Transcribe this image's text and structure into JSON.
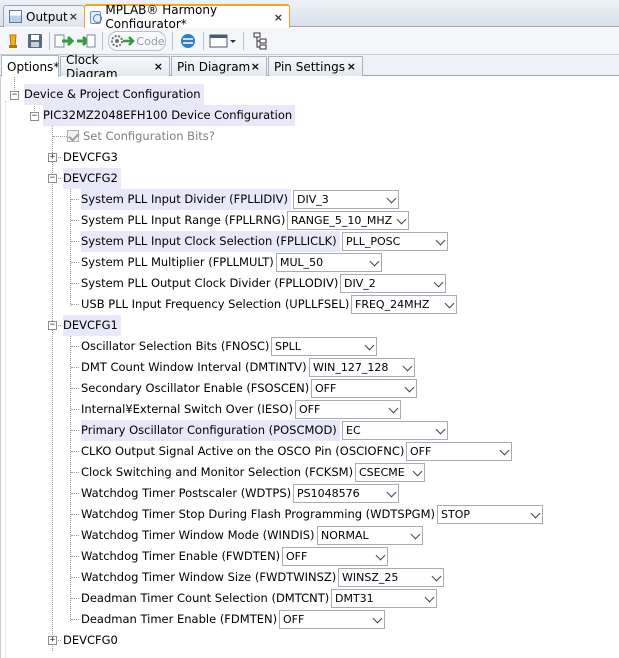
{
  "window_tabs": [
    {
      "label": "Output",
      "icon": "output-window-icon"
    },
    {
      "label": "MPLAB® Harmony Configurator*",
      "icon": "harmony-icon"
    }
  ],
  "toolbar": {
    "code_label": "Code",
    "icons": [
      "generate-icon",
      "save-icon",
      "import-icon",
      "export-icon",
      "generate-code-icon",
      "harmony-framework-icon",
      "window-layout-icon",
      "tree-view-icon"
    ]
  },
  "option_tabs": [
    {
      "label": "Options*"
    },
    {
      "label": "Clock Diagram"
    },
    {
      "label": "Pin Diagram"
    },
    {
      "label": "Pin Settings"
    }
  ],
  "tree": {
    "root": "Device & Project Configuration",
    "device": "PIC32MZ2048EFH100 Device Configuration",
    "set_config_bits": "Set Configuration Bits?",
    "devcfg3": "DEVCFG3",
    "devcfg2": "DEVCFG2",
    "devcfg1": "DEVCFG1",
    "devcfg0": "DEVCFG0",
    "devcfg2_settings": [
      {
        "label": "System PLL Input Divider (FPLLIDIV)",
        "value": "DIV_3",
        "selected": true
      },
      {
        "label": "System PLL Input Range (FPLLRNG)",
        "value": "RANGE_5_10_MHZ",
        "selected": false
      },
      {
        "label": "System PLL Input Clock Selection (FPLLICLK)",
        "value": "PLL_POSC",
        "selected": true
      },
      {
        "label": "System PLL Multiplier (FPLLMULT)",
        "value": "MUL_50",
        "selected": false
      },
      {
        "label": "System PLL Output Clock Divider (FPLLODIV)",
        "value": "DIV_2",
        "selected": false
      },
      {
        "label": "USB PLL Input Frequency Selection (UPLLFSEL)",
        "value": "FREQ_24MHZ",
        "selected": false
      }
    ],
    "devcfg1_settings": [
      {
        "label": "Oscillator Selection Bits (FNOSC)",
        "value": "SPLL",
        "selected": false
      },
      {
        "label": "DMT Count Window Interval (DMTINTV)",
        "value": "WIN_127_128",
        "selected": false
      },
      {
        "label": "Secondary Oscillator Enable (FSOSCEN)",
        "value": "OFF",
        "selected": false
      },
      {
        "label": "Internal¥External Switch Over (IESO)",
        "value": "OFF",
        "selected": false
      },
      {
        "label": "Primary Oscillator Configuration (POSCMOD)",
        "value": "EC",
        "selected": true
      },
      {
        "label": "CLKO Output Signal Active on the OSCO Pin (OSCIOFNC)",
        "value": "OFF",
        "selected": false
      },
      {
        "label": "Clock Switching and Monitor Selection (FCKSM)",
        "value": "CSECME",
        "selected": false
      },
      {
        "label": "Watchdog Timer Postscaler (WDTPS)",
        "value": "PS1048576",
        "selected": false
      },
      {
        "label": "Watchdog Timer Stop During Flash Programming (WDTSPGM)",
        "value": "STOP",
        "selected": false
      },
      {
        "label": "Watchdog Timer Window Mode (WINDIS)",
        "value": "NORMAL",
        "selected": false
      },
      {
        "label": "Watchdog Timer Enable (FWDTEN)",
        "value": "OFF",
        "selected": false
      },
      {
        "label": "Watchdog Timer Window Size (FWDTWINSZ)",
        "value": "WINSZ_25",
        "selected": false
      },
      {
        "label": "Deadman Timer Count Selection (DMTCNT)",
        "value": "DMT31",
        "selected": false
      },
      {
        "label": "Deadman Timer Enable (FDMTEN)",
        "value": "OFF",
        "selected": false
      }
    ]
  }
}
